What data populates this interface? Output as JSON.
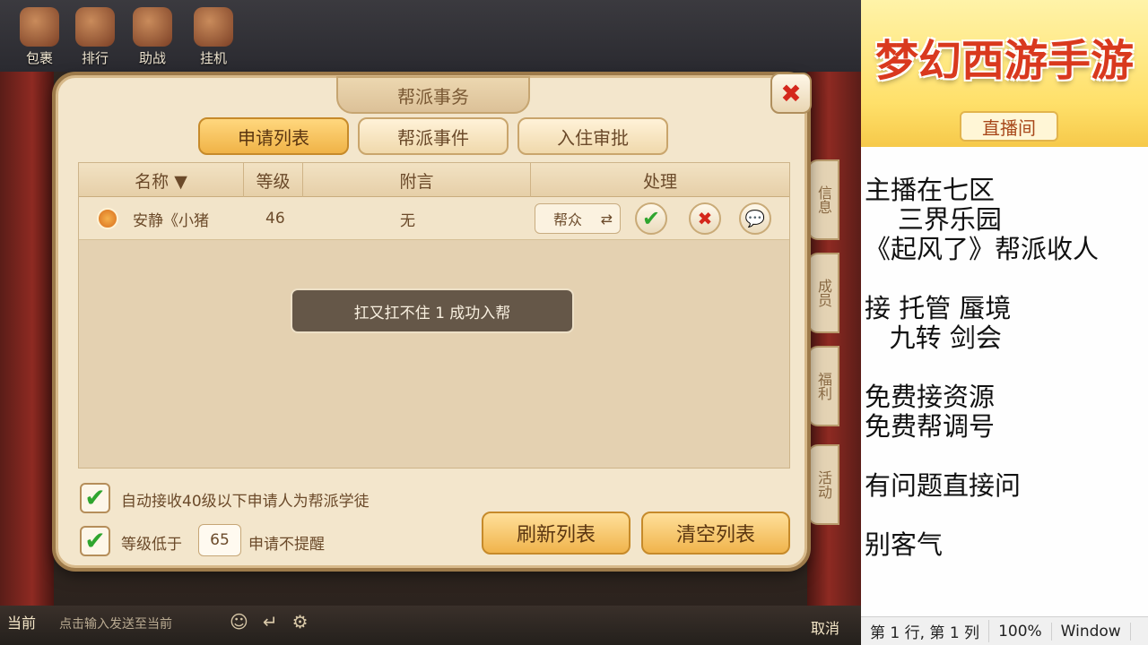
{
  "game": {
    "top_icons": [
      "包裹",
      "排行",
      "助战",
      "挂机"
    ],
    "side_tabs": [
      "信息",
      "成员",
      "福利",
      "活动"
    ],
    "chat": {
      "channel": "当前",
      "hint": "点击输入发送至当前",
      "cancel": "取消"
    }
  },
  "dialog": {
    "title": "帮派事务",
    "tabs": [
      {
        "label": "申请列表",
        "active": true
      },
      {
        "label": "帮派事件",
        "active": false
      },
      {
        "label": "入住审批",
        "active": false
      }
    ],
    "columns": {
      "name": "名称 ▼",
      "level": "等级",
      "note": "附言",
      "action": "处理"
    },
    "row": {
      "name": "安静《小猪",
      "level": "46",
      "note": "无",
      "role": "帮众"
    },
    "toast": "扛又扛不住 1 成功入帮",
    "options": {
      "auto_accept": "自动接收40级以下申请人为帮派学徒",
      "level_below": "等级低于",
      "level_value": "65",
      "no_remind": "申请不提醒"
    },
    "buttons": {
      "refresh": "刷新列表",
      "clear": "清空列表"
    }
  },
  "overlay": {
    "title": "梦幻西游手游",
    "subtitle": "直播间",
    "notes": [
      "主播在七区",
      "    三界乐园",
      "《起风了》帮派收人",
      "",
      "接 托管 蜃境",
      "   九转 剑会",
      "",
      "免费接资源",
      "免费帮调号",
      "",
      "有问题直接问",
      "",
      "别客气"
    ],
    "status": {
      "position": "第 1 行, 第 1 列",
      "zoom": "100%",
      "os": "Window"
    }
  },
  "colors": {
    "accent": "#f0b347",
    "confirm": "#2fa52f",
    "reject": "#d4271c",
    "brand": "#d9391e"
  }
}
